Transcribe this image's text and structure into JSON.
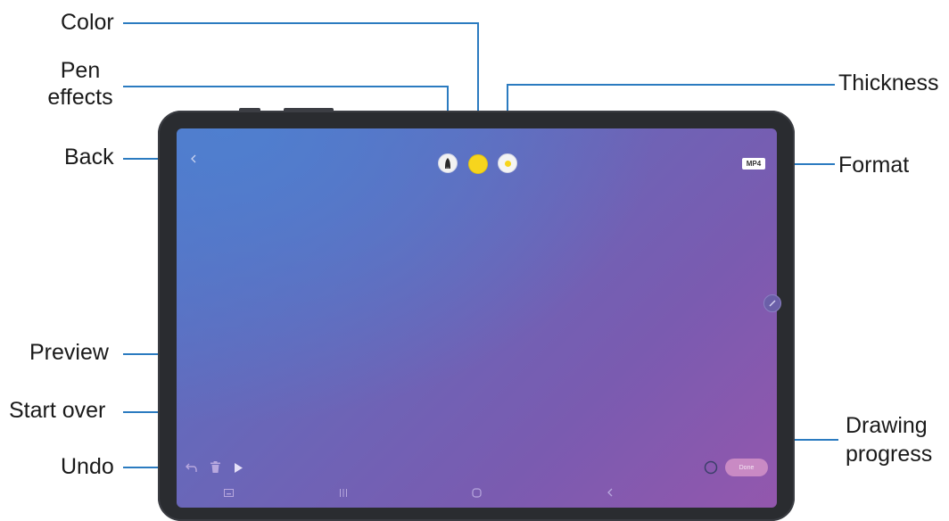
{
  "labels": {
    "color": "Color",
    "pen_effects": "Pen\neffects",
    "back": "Back",
    "preview": "Preview",
    "start_over": "Start over",
    "undo": "Undo",
    "thickness": "Thickness",
    "format": "Format",
    "drawing_progress": "Drawing\nprogress"
  },
  "screen": {
    "format_badge": "MP4",
    "done_label": "Done",
    "selected_color": "#f7d51d"
  },
  "colors": {
    "callout_line": "#2b7bc0",
    "bezel": "#2a2c30"
  },
  "icons": {
    "back": "chevron-left-icon",
    "pen_effects": "pen-nib-icon",
    "thickness": "thickness-dot-icon",
    "undo": "undo-icon",
    "start_over": "trash-icon",
    "preview": "play-icon",
    "drawing_progress": "progress-ring-icon",
    "nav_recents": "recents-icon",
    "nav_home": "home-icon",
    "nav_back": "nav-back-icon",
    "nav_keyboard": "keyboard-icon",
    "side_pen": "edit-pen-icon"
  }
}
